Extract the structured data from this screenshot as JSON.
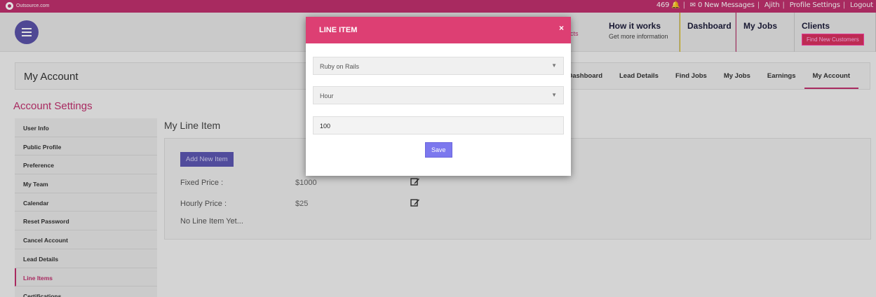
{
  "topbar": {
    "logo_text": "Outsource.com",
    "count": "469",
    "messages": "0 New Messages",
    "user": "Ajith",
    "profile_settings": "Profile Settings",
    "logout": "Logout"
  },
  "header": {
    "contacts_fragment": "cts",
    "nav": [
      {
        "title": "How it works",
        "subtitle": "Get more information"
      },
      {
        "title": "Dashboard"
      },
      {
        "title": "My Jobs"
      },
      {
        "title": "Clients",
        "button": "Find New Customers"
      }
    ]
  },
  "page": {
    "title": "My Account",
    "tabs": [
      "Dashboard",
      "Lead Details",
      "Find Jobs",
      "My Jobs",
      "Earnings",
      "My Account"
    ],
    "active_tab": "My Account"
  },
  "sidebar": {
    "heading": "Account Settings",
    "items": [
      "User Info",
      "Public Profile",
      "Preference",
      "My Team",
      "Calendar",
      "Reset Password",
      "Cancel Account",
      "Lead Details",
      "Line Items",
      "Certifications"
    ],
    "active": "Line Items"
  },
  "main": {
    "title": "My Line Item",
    "add_button": "Add New Item",
    "rows": [
      {
        "label": "Fixed Price :",
        "value": "$1000"
      },
      {
        "label": "Hourly Price :",
        "value": "$25"
      }
    ],
    "empty_text": "No Line Item Yet..."
  },
  "modal": {
    "title": "LINE ITEM",
    "close": "×",
    "select_skill": "Ruby on Rails",
    "select_unit": "Hour",
    "amount": "100",
    "save": "Save"
  },
  "colors": {
    "brand": "#c0306e",
    "modal_header": "#dd3f73",
    "primary_button": "#5d57b2"
  }
}
